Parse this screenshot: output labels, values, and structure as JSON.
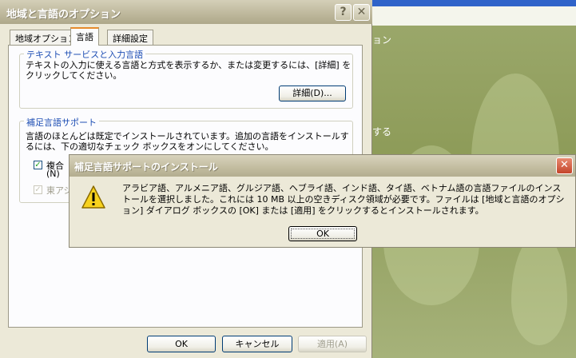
{
  "background_window": {
    "text1": "ョン",
    "text2": "する"
  },
  "dialog": {
    "title": "地域と言語のオプション",
    "tabs": [
      {
        "label": "地域オプション"
      },
      {
        "label": "言語"
      },
      {
        "label": "詳細設定"
      }
    ],
    "text_services_group": {
      "title": "テキスト サービスと入力言語",
      "description": "テキストの入力に使える言語と方式を表示するか、または変更するには、[詳細] をクリックしてください。",
      "details_button": "詳細(D)..."
    },
    "supplemental_group": {
      "title": "補足言語サポート",
      "description": "言語のほとんどは既定でインストールされています。追加の言語をインストールするには、下の適切なチェック ボックスをオンにしてください。",
      "checkbox1_label": "複合",
      "checkbox1_accel": "(N)",
      "checkbox2_label": "東アジ"
    },
    "ok_button": "OK",
    "cancel_button": "キャンセル",
    "apply_button": "適用(A)"
  },
  "message_box": {
    "title": "補足言語サポートのインストール",
    "text": "アラビア語、アルメニア語、グルジア語、ヘブライ語、インド語、タイ語、ベトナム語の言語ファイルのインストールを選択しました。これには 10 MB 以上の空きディスク領域が必要です。ファイルは [地域と言語のオプション] ダイアログ ボックスの [OK] または [適用] をクリックするとインストールされます。",
    "ok_button": "OK",
    "icon": "warning-icon"
  },
  "colors": {
    "group_title": "#1f4fb4",
    "selected_tab_accent": "#e68b2c"
  }
}
